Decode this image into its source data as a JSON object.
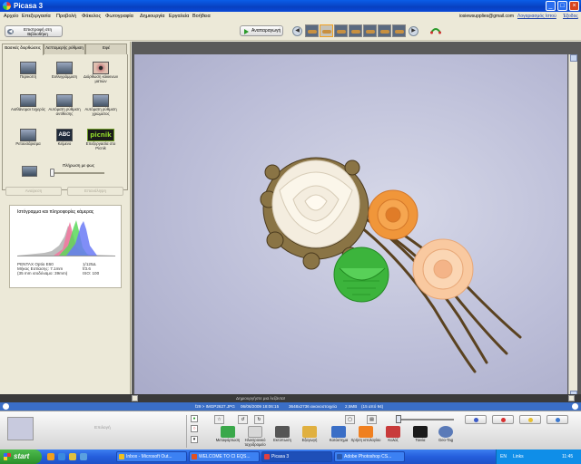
{
  "window": {
    "title": "Picasa 3",
    "min": "_",
    "max": "□",
    "close": "×"
  },
  "menu": {
    "items": [
      "Αρχείο",
      "Επεξεργασία",
      "Προβολή",
      "Φάκελος",
      "Φωτογραφία",
      "Δημιουργία",
      "Εργαλεία",
      "Βοήθεια"
    ],
    "email": "iosiewsupplies@gmail.com",
    "account_link": "Λογαριασμός Ιστού",
    "signout_link": "Έξοδος"
  },
  "toolbar": {
    "back_label": "Επιστροφή στη Βιβλιοθήκη",
    "back_arrow": "◀",
    "play_label": "Αναπαραγωγή",
    "prev": "◀",
    "next": "▶"
  },
  "left": {
    "tabs": [
      "Βασικές διορθώσεις",
      "Λεπτομερής ρύθμιση",
      "Εφέ"
    ],
    "tools": [
      {
        "label": "Περικοπή",
        "icon": "crop-icon"
      },
      {
        "label": "Ευθυγράμμιση",
        "icon": "straighten-icon"
      },
      {
        "label": "Διόρθωση κόκκινων ματιών",
        "icon": "redeye-icon"
      },
      {
        "label": "Αισθάνομαι τυχερός",
        "icon": "lucky-icon"
      },
      {
        "label": "Αυτόματη ρύθμιση αντίθεσης",
        "icon": "auto-contrast-icon"
      },
      {
        "label": "Αυτόματη ρύθμιση χρώματος",
        "icon": "auto-color-icon"
      },
      {
        "label": "Ρετουσάρισμα",
        "icon": "retouch-icon"
      },
      {
        "label": "Κείμενο",
        "icon": "text-icon"
      },
      {
        "label": "Επεξεργασία στο Picnik",
        "icon": "picnik-icon"
      }
    ],
    "text_icon_glyph": "ABC",
    "picnik_logo": "picnik",
    "fill_light_label": "Πλήρωση με φως",
    "undo_label": "Αναίρεση",
    "redo_label": "Επανάληψη",
    "histogram_title": "Ιστόγραμμα και πληροφορίες κάμερας",
    "camera_model": "PENTAX Optio E60",
    "focal_length": "Μήκος Εστίασης: 7.1mm",
    "equiv_35mm": "(35 mm ισοδύναμο: 39mm)",
    "shutter": "1/125Δ",
    "aperture": "f/3.6",
    "iso": "ISO: 100"
  },
  "main": {
    "caption": "Δημιουργήστε μια λεζάντα!"
  },
  "status": {
    "sequence": "f29 > IMGP2627.JPG",
    "date": "06/06/2009 18:06:15",
    "dims": "3648x2736 εικονοστοιχεία",
    "size": "2,5MB",
    "position": "(15 από 94)"
  },
  "tray": {
    "selection_label": "Επιλογή",
    "actions": [
      {
        "label": "Μεταφόρτωση",
        "icon": "upload-icon",
        "color": "#3aa84a"
      },
      {
        "label": "Ηλεκτρονικό ταχυδρομείο",
        "icon": "email-icon",
        "color": "#d8d8d8"
      },
      {
        "label": "Εκτύπωση",
        "icon": "print-icon",
        "color": "#555555"
      },
      {
        "label": "Εξαγωγή",
        "icon": "export-icon",
        "color": "#e0b040"
      },
      {
        "label": "Κατάστημα",
        "icon": "shop-icon",
        "color": "#3a6ec6"
      },
      {
        "label": "Χρήση ιστολογίου",
        "icon": "blogger-icon",
        "color": "#f08020"
      },
      {
        "label": "Κολάζ",
        "icon": "collage-icon",
        "color": "#c83a3a"
      },
      {
        "label": "Ταινία",
        "icon": "movie-icon",
        "color": "#1a1a1a"
      },
      {
        "label": "Geo-Tag",
        "icon": "geotag-icon",
        "color": "#5a7ab8"
      }
    ]
  },
  "taskbar": {
    "start": "start",
    "tasks": [
      {
        "label": "Inbox - Microsoft Out...",
        "color": "#f0c020"
      },
      {
        "label": "WELCOME TO CI EQS...",
        "color": "#e05020"
      },
      {
        "label": "Picasa 3",
        "color": "#e04040"
      },
      {
        "label": "Adobe Photoshop CS...",
        "color": "#2a5ab0"
      }
    ],
    "lang": "EN",
    "links": "Links",
    "time": "11:45"
  },
  "histogram": {
    "colors": {
      "blue": "#5a6af0",
      "green": "#3ac83a",
      "red": "#f05a8a",
      "gray": "#aaaaaa"
    }
  }
}
